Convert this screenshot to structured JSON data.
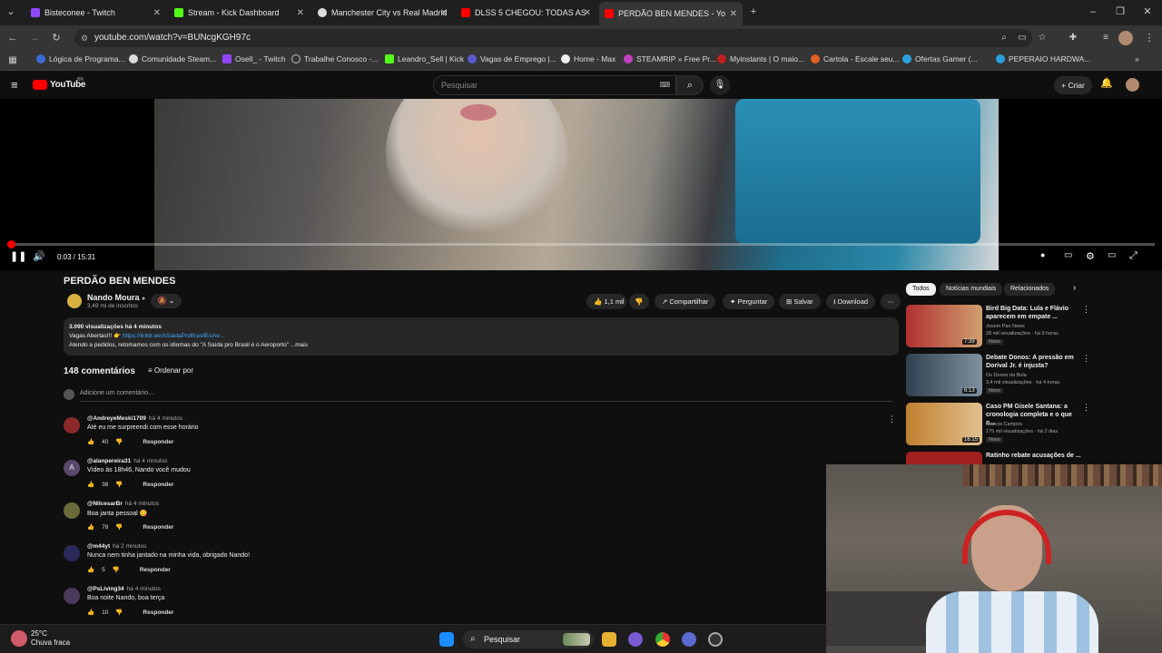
{
  "browser": {
    "tabs": [
      {
        "title": "Bisteconee - Twitch",
        "color": "#9146ff"
      },
      {
        "title": "Stream - Kick Dashboard",
        "color": "#53fc18"
      },
      {
        "title": "Manchester City vs Real Madrid",
        "color": "#888888"
      },
      {
        "title": "DLSS 5 CHEGOU: TODAS AS",
        "color": "#ff0000"
      },
      {
        "title": "PERDÃO BEN MENDES - Yo",
        "color": "#ff0000"
      }
    ],
    "url": "youtube.com/watch?v=BUNcgKGH97c",
    "bookmarks": [
      "Lógica de Programa...",
      "Comunidade Steam...",
      "Osell_ - Twitch",
      "Trabalhe Conosco -...",
      "Leandro_Sell | Kick",
      "Vagas de Emprego |...",
      "Home - Max",
      "STEAMRIP » Free Pr...",
      "Myinstants | O maio...",
      "Cartola - Escale seu...",
      "Ofertas Gamer (...",
      "PEPERAIO HARDWA..."
    ]
  },
  "youtube": {
    "logo": "YouTube",
    "country": "BR",
    "search_placeholder": "Pesquisar",
    "create_label": "Criar"
  },
  "player": {
    "timecode": "0:03 / 15:31",
    "progress_fraction": 0.0032
  },
  "video": {
    "title": "PERDÃO BEN MENDES",
    "channel": "Nando Moura",
    "subscribers": "3,49 mi de inscritos",
    "likes": "1,1 mil",
    "share_label": "Compartilhar",
    "ask_label": "Perguntar",
    "save_label": "Salvar",
    "download_label": "Download"
  },
  "description": {
    "stats": "3.090 visualizações  há 4 minutos",
    "line2_prefix": "Vagas Abertas!!! 👉",
    "line2_link": "https://linktr.ee/ASaidaProBrasilEoAe...",
    "line3": "Atendo a pedidos, retomamos com os idiomas do \"A Saída pro Brasil é o Aeroporto\" ...mais"
  },
  "comments": {
    "count_label": "148 comentários",
    "sort_label": "Ordenar por",
    "add_placeholder": "Adicione um comentário...",
    "reply_label": "Responder",
    "items": [
      {
        "author": "@AndreyeMeski1709",
        "time": "há 4 minutos",
        "text": "Até eu me surpreendi com esse horário",
        "likes": "40",
        "avatar": "",
        "avatar_color": "#8a2a2a"
      },
      {
        "author": "@alanpereira31",
        "time": "há 4 minutos",
        "text": "Vídeo às 18h46, Nando você mudou",
        "likes": "38",
        "avatar": "A",
        "avatar_color": "#5a4a6a"
      },
      {
        "author": "@NilcesarBr",
        "time": "há 4 minutos",
        "text": "Boa janta pessoal 😋",
        "likes": "78",
        "avatar": "",
        "avatar_color": "#6a6a3a"
      },
      {
        "author": "@m44yt",
        "time": "há 2 minutos",
        "text": "Nunca nem tinha jantado na minha vida, obrigado Nando!",
        "likes": "5",
        "avatar": "",
        "avatar_color": "#2a2a5a"
      },
      {
        "author": "@PsLiving34",
        "time": "há 4 minutos",
        "text": "Boa noite Nando, boa terça",
        "likes": "10",
        "avatar": "",
        "avatar_color": "#4a3a5a"
      }
    ]
  },
  "sidebar": {
    "chips": [
      "Todos",
      "Notícias mundiais",
      "Relacionados"
    ],
    "recommendations": [
      {
        "title": "Bird Big Data: Lula e Flávio aparecem em empate ...",
        "channel": "Jovem Pan News",
        "meta": "28 mil visualizações · há 9 horas",
        "duration": "7:39",
        "badge": "Novo",
        "thumb": "#b03030"
      },
      {
        "title": "Debate Donos: A pressão em Dorival Jr. é injusta?",
        "channel": "Os Donos da Bola",
        "meta": "3,4 mil visualizações · há 4 horas",
        "duration": "6:13",
        "badge": "Novo",
        "thumb": "#506070"
      },
      {
        "title": "Caso PM Gisele Santana: a cronologia completa e o que o...",
        "channel": "Marcos Campos",
        "meta": "175 mil visualizações · há 2 dias",
        "duration": "16:15",
        "badge": "Novo",
        "thumb": "#c08030"
      },
      {
        "title": "Ratinho rebate acusações de ...",
        "channel": "",
        "meta": "",
        "duration": "",
        "badge": "",
        "thumb": "#a02020"
      }
    ]
  },
  "taskbar": {
    "temperature": "25°C",
    "weather": "Chuva fraca",
    "search_label": "Pesquisar"
  }
}
